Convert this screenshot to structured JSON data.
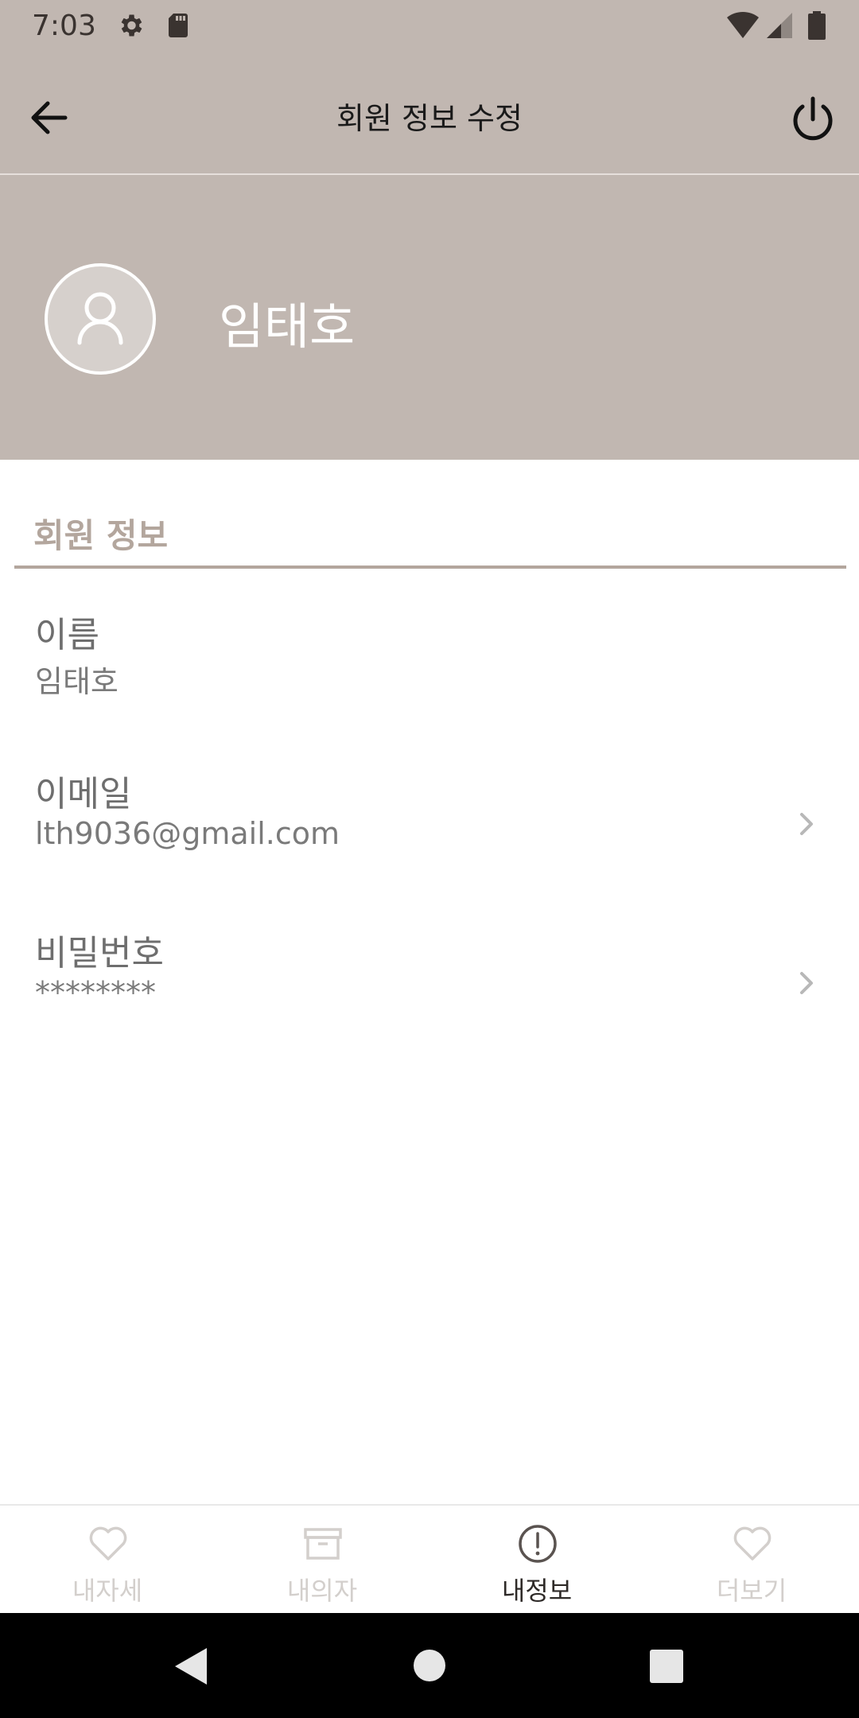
{
  "status_bar": {
    "time": "7:03",
    "icons": [
      "gear-icon",
      "sd-card-icon",
      "wifi-icon",
      "signal-icon",
      "battery-icon"
    ]
  },
  "app_bar": {
    "title": "회원 정보 수정",
    "back_icon": "arrow-left-icon",
    "power_icon": "power-icon"
  },
  "profile": {
    "name": "임태호",
    "avatar_icon": "person-icon"
  },
  "section": {
    "title": "회원 정보"
  },
  "fields": [
    {
      "label": "이름",
      "value": "임태호",
      "has_chevron": false
    },
    {
      "label": "이메일",
      "value": "lth9036@gmail.com",
      "has_chevron": true
    },
    {
      "label": "비밀번호",
      "value": "********",
      "has_chevron": true
    }
  ],
  "bottom_nav": {
    "items": [
      {
        "label": "내자세",
        "icon": "heart-icon",
        "active": false
      },
      {
        "label": "내의자",
        "icon": "archive-box-icon",
        "active": false
      },
      {
        "label": "내정보",
        "icon": "info-circle-icon",
        "active": true
      },
      {
        "label": "더보기",
        "icon": "heart-icon",
        "active": false
      }
    ]
  },
  "system_nav": {
    "icons": [
      "back-triangle-icon",
      "home-circle-icon",
      "recents-square-icon"
    ]
  },
  "colors": {
    "header_bg": "#c1b7b1",
    "accent": "#b3a69d",
    "nav_inactive": "#d3cfcc",
    "nav_active": "#2e2a28"
  }
}
